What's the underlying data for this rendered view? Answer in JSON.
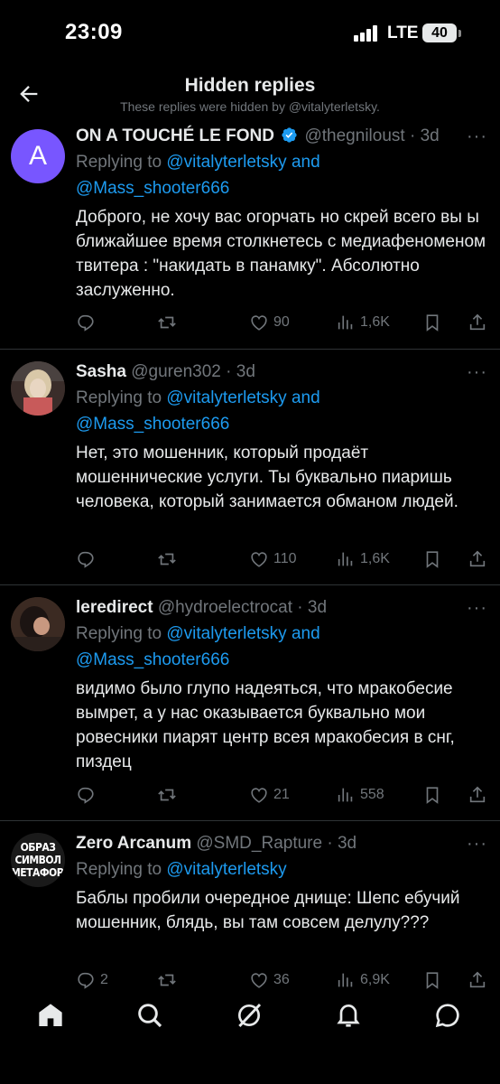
{
  "status_bar": {
    "time": "23:09",
    "network": "LTE",
    "battery": "40"
  },
  "header": {
    "title": "Hidden replies",
    "subtitle": "These replies were hidden by @vitalyterletsky."
  },
  "tweets": [
    {
      "avatar_letter": "A",
      "name": "ON A TOUCHÉ LE FOND",
      "verified": true,
      "handle": "@thegniloust",
      "time": "3d",
      "replying_prefix": "Replying to",
      "mention1": "@vitalyterletsky",
      "and": "and",
      "mention2": "@Mass_shooter666",
      "text": "Доброго, не хочу вас огорчать но скрей всего вы ы ближайшее время столкнетесь с медиафеноменом твитера : \"накидать в панамку\". Абсолютно заслуженно.",
      "replies": "",
      "retweets": "",
      "likes": "90",
      "views": "1,6K"
    },
    {
      "name": "Sasha",
      "verified": false,
      "handle": "@guren302",
      "time": "3d",
      "replying_prefix": "Replying to",
      "mention1": "@vitalyterletsky",
      "and": "and",
      "mention2": "@Mass_shooter666",
      "text": "Нет, это мошенник, который продаёт мошеннические услуги. Ты буквально пиаришь человека, который занимается обманом людей.",
      "replies": "",
      "retweets": "",
      "likes": "110",
      "views": "1,6K"
    },
    {
      "name": "leredirect",
      "verified": false,
      "handle": "@hydroelectrocat",
      "time": "3d",
      "replying_prefix": "Replying to",
      "mention1": "@vitalyterletsky",
      "and": "and",
      "mention2": "@Mass_shooter666",
      "text": "видимо было глупо надеяться, что мракобесие вымрет, а у нас оказывается буквально мои ровесники пиарят центр всея мракобесия в снг, пиздец",
      "replies": "",
      "retweets": "",
      "likes": "21",
      "views": "558"
    },
    {
      "avatar_text": [
        "ОБРАЗ",
        "СИМВОЛ",
        "МЕТАФОРА"
      ],
      "name": "Zero Arcanum",
      "verified": false,
      "handle": "@SMD_Rapture",
      "time": "3d",
      "replying_prefix": "Replying to",
      "mention1": "@vitalyterletsky",
      "text": "Баблы пробили очередное днище: Шепс ебучий мошенник, блядь, вы там совсем делулу???",
      "replies": "2",
      "retweets": "",
      "likes": "36",
      "views": "6,9K"
    }
  ],
  "nav": [
    "home-icon",
    "search-icon",
    "grok-icon",
    "notifications-icon",
    "messages-icon"
  ],
  "colors": {
    "accent": "#1d9bf0",
    "muted": "#71767b",
    "text": "#e7e9ea",
    "avatar_a": "#7856ff"
  }
}
